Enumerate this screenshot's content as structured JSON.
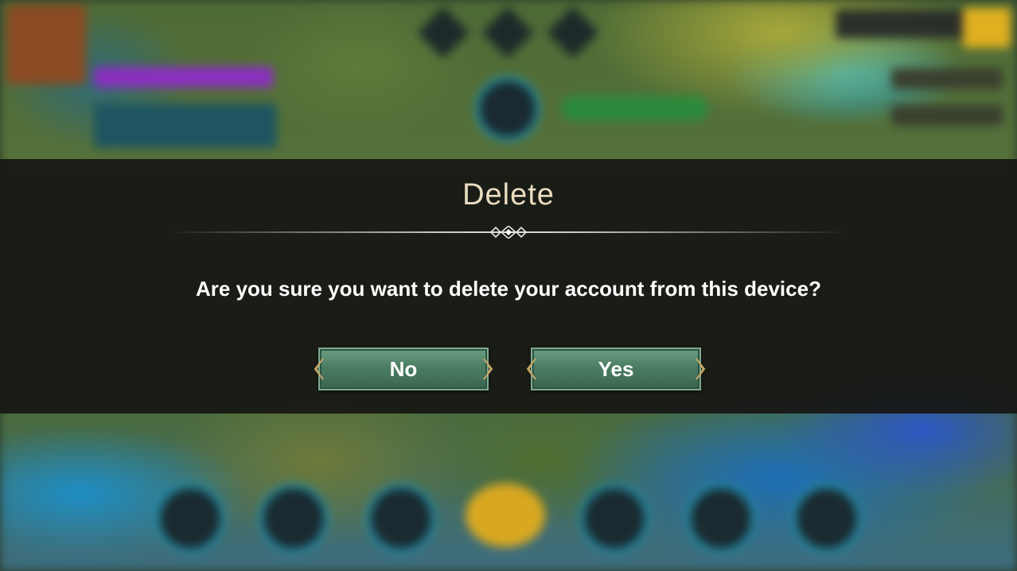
{
  "dialog": {
    "title": "Delete",
    "message": "Are you sure you want to delete your account from this device?",
    "no_label": "No",
    "yes_label": "Yes"
  },
  "colors": {
    "title": "#eadcc0",
    "button_green": "#4c7d63",
    "overlay": "#161614"
  }
}
